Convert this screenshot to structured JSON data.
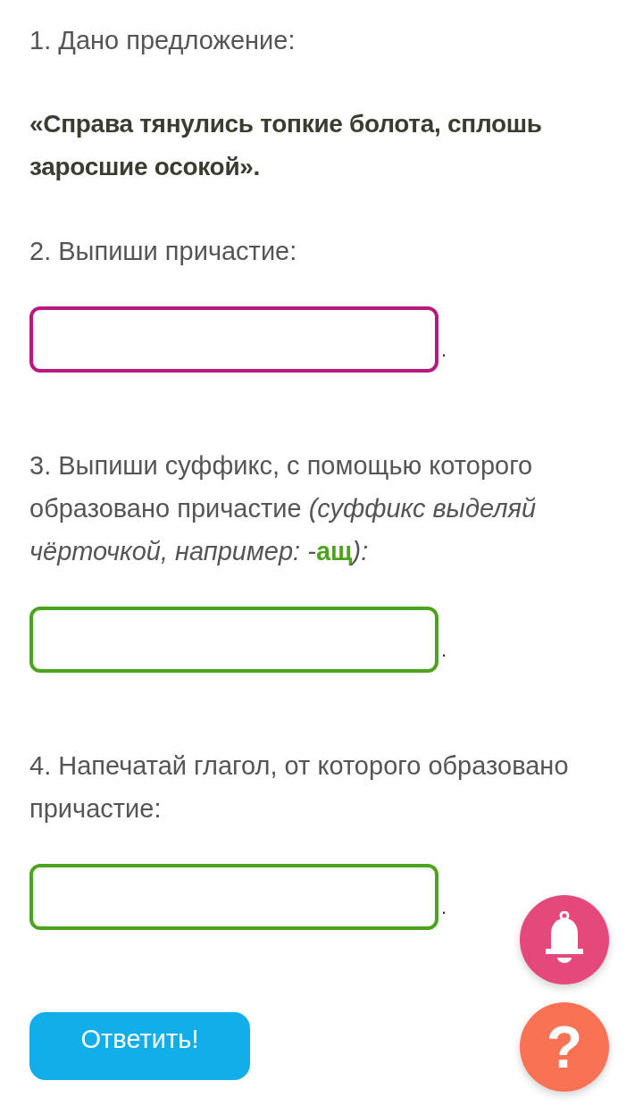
{
  "blocks": [
    {
      "kind": "text",
      "text": "1. Дано предложение:"
    },
    {
      "kind": "quote",
      "text": "«Справа тянулись топкие болота, сплошь заросшие осокой»."
    },
    {
      "kind": "text",
      "text": "2. Выпиши причастие:"
    },
    {
      "kind": "field",
      "color": "#b8197c",
      "suffix": "."
    },
    {
      "kind": "hint",
      "text": "3. Выпиши суффикс, с помощью которого образовано причастие ",
      "hint": "(суффикс выделяй чёрточкой, например: -",
      "example": "ащ",
      "hint_end": "):"
    },
    {
      "kind": "field",
      "color": "#4ea31e",
      "suffix": "."
    },
    {
      "kind": "text",
      "text": "4. Напечатай глагол, от которого образовано причастие:"
    },
    {
      "kind": "field",
      "color": "#4ea31e",
      "suffix": "."
    }
  ],
  "submit_button": {
    "label": "Ответить!"
  },
  "floating_buttons": [
    {
      "kind": "bell",
      "color": "#e5487a"
    },
    {
      "kind": "help",
      "label": "?",
      "color": "#fa7254"
    }
  ]
}
